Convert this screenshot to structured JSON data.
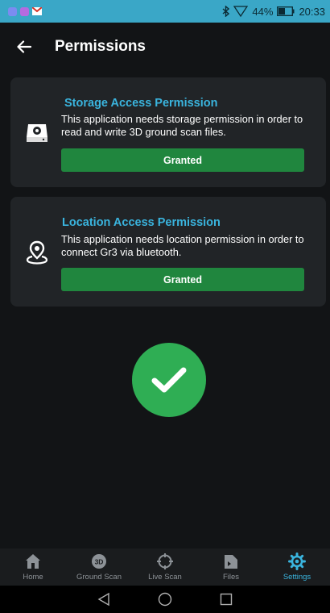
{
  "status_bar": {
    "battery": "44%",
    "time": "20:33",
    "notification_icons": [
      "notification-app-icon",
      "notification-app-icon",
      "gmail-icon"
    ]
  },
  "app_bar": {
    "title": "Permissions",
    "back_icon": "arrow-left-icon"
  },
  "permissions": [
    {
      "icon": "hard-drive-icon",
      "title": "Storage Access Permission",
      "description": " This application needs storage permission in order to read and write 3D ground scan files.",
      "button_label": "Granted"
    },
    {
      "icon": "location-pin-icon",
      "title": "Location Access Permission",
      "description": "This application needs location permission in order to connect Gr3 via bluetooth.",
      "button_label": "Granted"
    }
  ],
  "status_icon": "checkmark-icon",
  "bottom_nav": {
    "items": [
      {
        "label": "Home",
        "icon": "home-icon",
        "active": false
      },
      {
        "label": "Ground Scan",
        "icon": "3d-icon",
        "active": false
      },
      {
        "label": "Live Scan",
        "icon": "crosshair-icon",
        "active": false
      },
      {
        "label": "Files",
        "icon": "file-icon",
        "active": false
      },
      {
        "label": "Settings",
        "icon": "gear-icon",
        "active": true
      }
    ]
  },
  "colors": {
    "accent": "#3ab4de",
    "granted_button": "#20863e",
    "check_circle": "#2fae54",
    "status_bar": "#3aa7c7"
  }
}
